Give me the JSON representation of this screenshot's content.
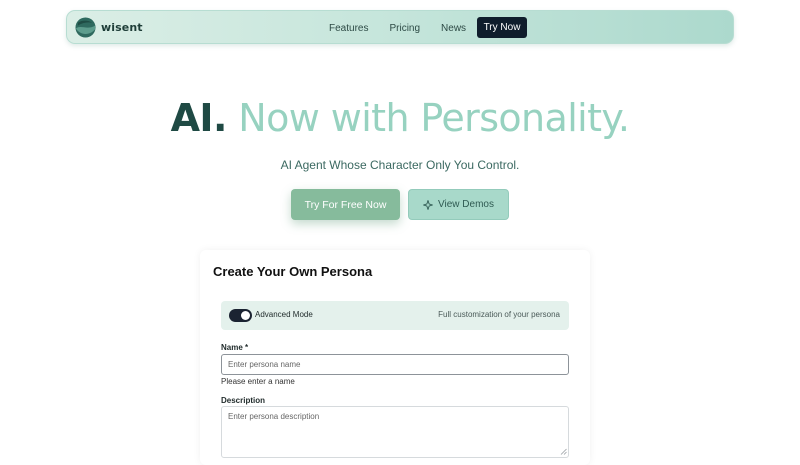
{
  "nav": {
    "brand": "wisent",
    "links": [
      "Features",
      "Pricing",
      "News"
    ],
    "cta": "Try Now"
  },
  "hero": {
    "title_lead": "AI.",
    "title_rest": "Now with Personality.",
    "subtitle": "AI Agent Whose Character Only You Control.",
    "primary_button": "Try For Free Now",
    "secondary_button": "View Demos",
    "secondary_icon": "sparkle-icon"
  },
  "persona_form": {
    "title": "Create Your Own Persona",
    "mode": {
      "label": "Advanced Mode",
      "enabled": true,
      "description": "Full customization of your persona"
    },
    "name": {
      "label": "Name *",
      "placeholder": "Enter persona name",
      "value": "",
      "error": "Please enter a name"
    },
    "description": {
      "label": "Description",
      "placeholder": "Enter persona description",
      "value": ""
    }
  },
  "colors": {
    "brand_dark": "#1f4a44",
    "brand_light": "#97d2c0",
    "cta_dark": "#0f1d2c",
    "primary_button": "#86bb9c",
    "secondary_button": "#a8d9ca"
  }
}
